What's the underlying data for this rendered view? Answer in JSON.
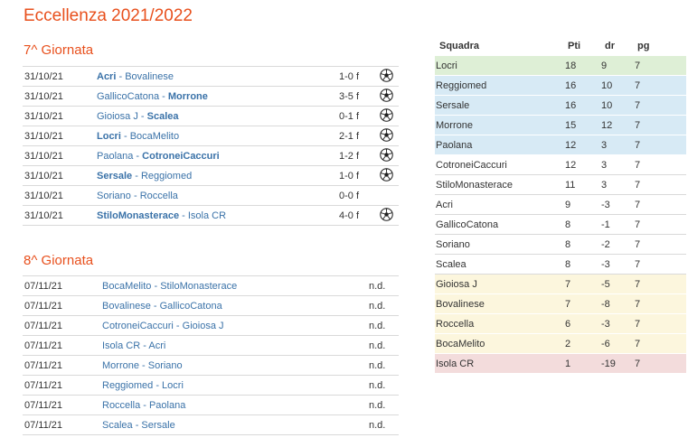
{
  "colors": {
    "title": "#e8501d",
    "team_link": "#3a72a8",
    "zone_green": "#deefd6",
    "zone_blue": "#d7eaf5",
    "zone_yellow": "#fcf6dd",
    "zone_red": "#f3dcdc",
    "zone_plain": "#ffffff",
    "row_divider": "#d9d9d9"
  },
  "page": {
    "title": "Eccellenza 2021/2022"
  },
  "rounds": [
    {
      "title": "7^ Giornata",
      "matches": [
        {
          "date": "31/10/21",
          "home": "Acri",
          "away": "Bovalinese",
          "bold": "home",
          "result": "1-0 f",
          "icon": "soccer-ball-icon"
        },
        {
          "date": "31/10/21",
          "home": "GallicoCatona",
          "away": "Morrone",
          "bold": "away",
          "result": "3-5 f",
          "icon": "soccer-ball-icon"
        },
        {
          "date": "31/10/21",
          "home": "Gioiosa J",
          "away": "Scalea",
          "bold": "away",
          "result": "0-1 f",
          "icon": "soccer-ball-icon"
        },
        {
          "date": "31/10/21",
          "home": "Locri",
          "away": "BocaMelito",
          "bold": "home",
          "result": "2-1 f",
          "icon": "soccer-ball-icon"
        },
        {
          "date": "31/10/21",
          "home": "Paolana",
          "away": "CotroneiCaccuri",
          "bold": "away",
          "result": "1-2 f",
          "icon": "soccer-ball-icon"
        },
        {
          "date": "31/10/21",
          "home": "Sersale",
          "away": "Reggiomed",
          "bold": "home",
          "result": "1-0 f",
          "icon": "soccer-ball-icon"
        },
        {
          "date": "31/10/21",
          "home": "Soriano",
          "away": "Roccella",
          "bold": "",
          "result": "0-0 f",
          "icon": ""
        },
        {
          "date": "31/10/21",
          "home": "StiloMonasterace",
          "away": "Isola CR",
          "bold": "home",
          "result": "4-0 f",
          "icon": "soccer-ball-icon"
        }
      ]
    },
    {
      "title": "8^ Giornata",
      "matches": [
        {
          "date": "07/11/21",
          "home": "BocaMelito",
          "away": "StiloMonasterace",
          "bold": "",
          "result": "n.d.",
          "icon": ""
        },
        {
          "date": "07/11/21",
          "home": "Bovalinese",
          "away": "GallicoCatona",
          "bold": "",
          "result": "n.d.",
          "icon": ""
        },
        {
          "date": "07/11/21",
          "home": "CotroneiCaccuri",
          "away": "Gioiosa J",
          "bold": "",
          "result": "n.d.",
          "icon": ""
        },
        {
          "date": "07/11/21",
          "home": "Isola CR",
          "away": "Acri",
          "bold": "",
          "result": "n.d.",
          "icon": ""
        },
        {
          "date": "07/11/21",
          "home": "Morrone",
          "away": "Soriano",
          "bold": "",
          "result": "n.d.",
          "icon": ""
        },
        {
          "date": "07/11/21",
          "home": "Reggiomed",
          "away": "Locri",
          "bold": "",
          "result": "n.d.",
          "icon": ""
        },
        {
          "date": "07/11/21",
          "home": "Roccella",
          "away": "Paolana",
          "bold": "",
          "result": "n.d.",
          "icon": ""
        },
        {
          "date": "07/11/21",
          "home": "Scalea",
          "away": "Sersale",
          "bold": "",
          "result": "n.d.",
          "icon": ""
        }
      ]
    }
  ],
  "standings": {
    "headers": {
      "team": "Squadra",
      "pti": "Pti",
      "dr": "dr",
      "pg": "pg"
    },
    "rows": [
      {
        "team": "Locri",
        "pti": "18",
        "dr": "9",
        "pg": "7",
        "zone": "zone_green"
      },
      {
        "team": "Reggiomed",
        "pti": "16",
        "dr": "10",
        "pg": "7",
        "zone": "zone_blue"
      },
      {
        "team": "Sersale",
        "pti": "16",
        "dr": "10",
        "pg": "7",
        "zone": "zone_blue"
      },
      {
        "team": "Morrone",
        "pti": "15",
        "dr": "12",
        "pg": "7",
        "zone": "zone_blue"
      },
      {
        "team": "Paolana",
        "pti": "12",
        "dr": "3",
        "pg": "7",
        "zone": "zone_blue"
      },
      {
        "team": "CotroneiCaccuri",
        "pti": "12",
        "dr": "3",
        "pg": "7",
        "zone": "zone_plain"
      },
      {
        "team": "StiloMonasterace",
        "pti": "11",
        "dr": "3",
        "pg": "7",
        "zone": "zone_plain"
      },
      {
        "team": "Acri",
        "pti": "9",
        "dr": "-3",
        "pg": "7",
        "zone": "zone_plain"
      },
      {
        "team": "GallicoCatona",
        "pti": "8",
        "dr": "-1",
        "pg": "7",
        "zone": "zone_plain"
      },
      {
        "team": "Soriano",
        "pti": "8",
        "dr": "-2",
        "pg": "7",
        "zone": "zone_plain"
      },
      {
        "team": "Scalea",
        "pti": "8",
        "dr": "-3",
        "pg": "7",
        "zone": "zone_plain"
      },
      {
        "team": "Gioiosa J",
        "pti": "7",
        "dr": "-5",
        "pg": "7",
        "zone": "zone_yellow"
      },
      {
        "team": "Bovalinese",
        "pti": "7",
        "dr": "-8",
        "pg": "7",
        "zone": "zone_yellow"
      },
      {
        "team": "Roccella",
        "pti": "6",
        "dr": "-3",
        "pg": "7",
        "zone": "zone_yellow"
      },
      {
        "team": "BocaMelito",
        "pti": "2",
        "dr": "-6",
        "pg": "7",
        "zone": "zone_yellow"
      },
      {
        "team": "Isola CR",
        "pti": "1",
        "dr": "-19",
        "pg": "7",
        "zone": "zone_red"
      }
    ]
  }
}
